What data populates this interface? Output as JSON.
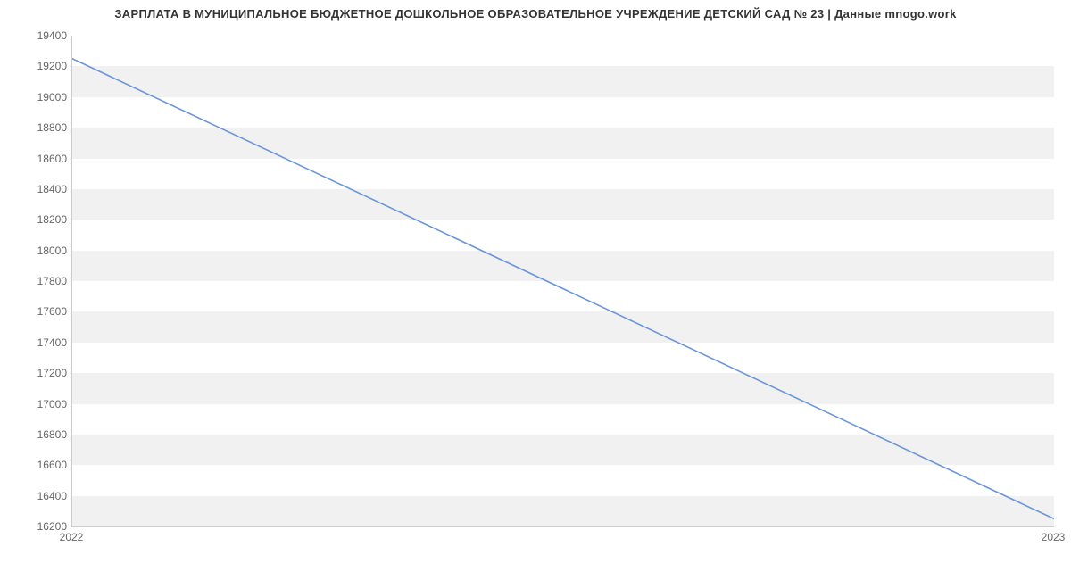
{
  "chart_data": {
    "type": "line",
    "title": "ЗАРПЛАТА В МУНИЦИПАЛЬНОЕ БЮДЖЕТНОЕ ДОШКОЛЬНОЕ ОБРАЗОВАТЕЛЬНОЕ УЧРЕЖДЕНИЕ ДЕТСКИЙ САД № 23 | Данные mnogo.work",
    "xlabel": "",
    "ylabel": "",
    "x_ticks": [
      "2022",
      "2023"
    ],
    "y_ticks": [
      16200,
      16400,
      16600,
      16800,
      17000,
      17200,
      17400,
      17600,
      17800,
      18000,
      18200,
      18400,
      18600,
      18800,
      19000,
      19200,
      19400
    ],
    "ylim": [
      16200,
      19400
    ],
    "x": [
      "2022",
      "2023"
    ],
    "values": [
      19250,
      16250
    ],
    "line_color": "#6c96d9"
  }
}
